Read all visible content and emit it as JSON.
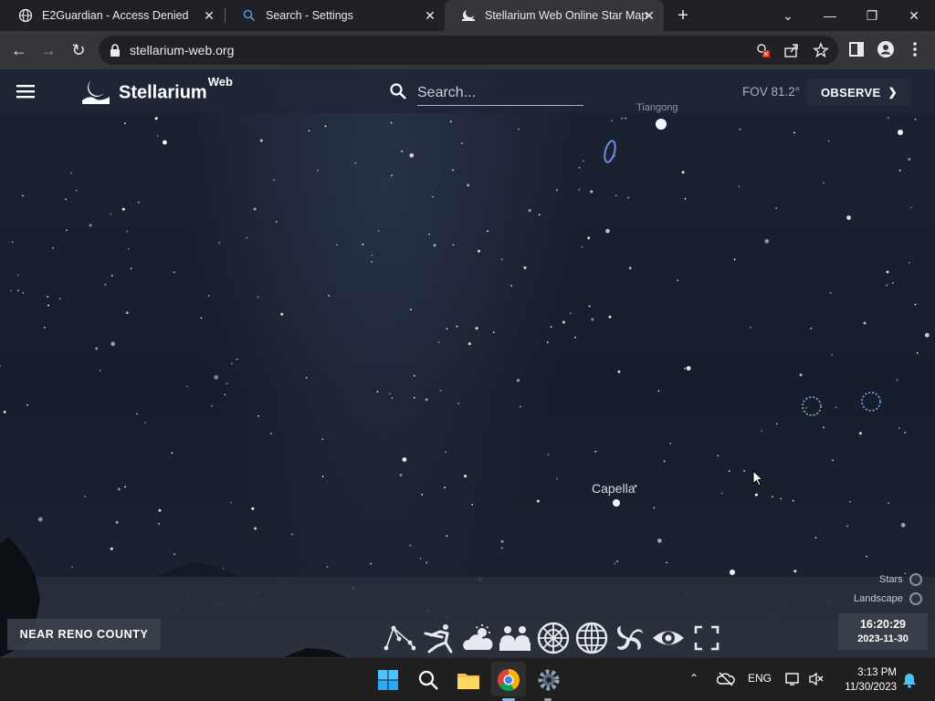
{
  "browser": {
    "tabs": [
      {
        "title": "E2Guardian - Access Denied",
        "icon": "globe-icon"
      },
      {
        "title": "Search - Settings",
        "icon": "search-icon"
      },
      {
        "title": "Stellarium Web Online Star Map",
        "icon": "stellarium-icon",
        "active": true
      }
    ],
    "url": "stellarium-web.org"
  },
  "app": {
    "brand": "Stellarium",
    "brand_sup": "Web",
    "search_placeholder": "Search...",
    "fov": "FOV 81.2°",
    "observe_label": "OBSERVE",
    "labels": {
      "tiangong": "Tiangong",
      "capella": "Capella"
    },
    "toggles": {
      "stars": "Stars",
      "landscape": "Landscape"
    },
    "location": "NEAR RENO COUNTY",
    "time": "16:20:29",
    "date": "2023-11-30",
    "toolbar_icons": [
      "constellation-lines-icon",
      "constellation-art-icon",
      "atmosphere-icon",
      "landscape-icon",
      "azimuthal-grid-icon",
      "equatorial-grid-icon",
      "deep-sky-objects-icon",
      "night-mode-icon",
      "fullscreen-icon"
    ]
  },
  "taskbar": {
    "lang": "ENG",
    "time": "3:13 PM",
    "date": "11/30/2023"
  },
  "colors": {
    "sky": "#1b2233",
    "browser_dark": "#202124",
    "browser_toolbar": "#35363a",
    "taskbar": "#1f1f1f"
  }
}
